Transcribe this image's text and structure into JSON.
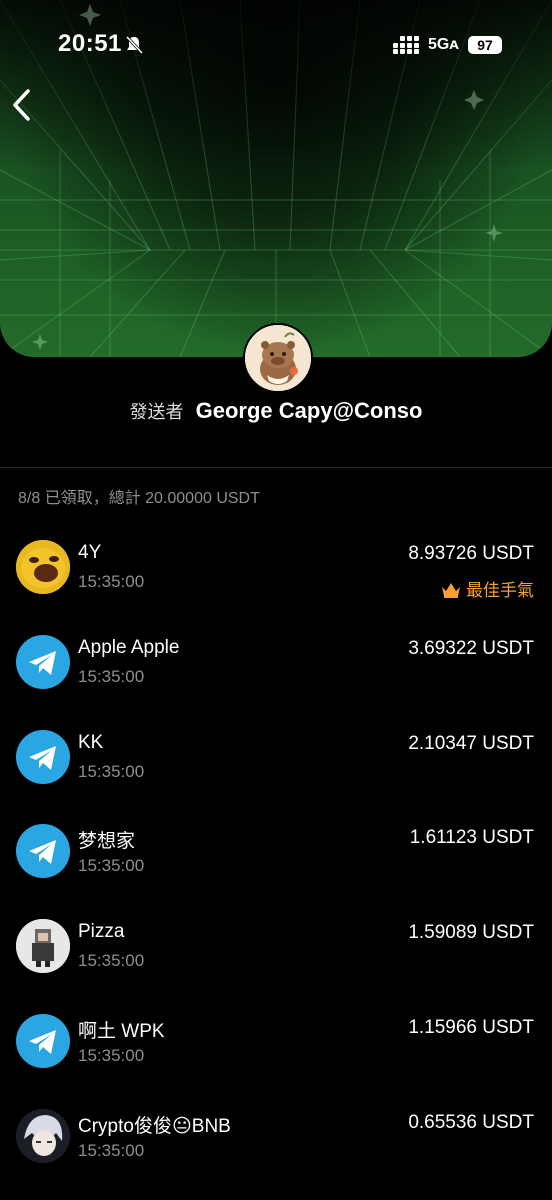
{
  "status_bar": {
    "time": "20:51",
    "network": "5Gᴀ",
    "battery": "97"
  },
  "sender": {
    "label": "發送者",
    "name": "George Capy@Conso"
  },
  "summary": "8/8 已領取，總計 20.00000 USDT",
  "best_label": "最佳手氣",
  "receivers": [
    {
      "name": "4Y",
      "time": "15:35:00",
      "amount": "8.93726 USDT",
      "avatar": "emoji-avatar",
      "best": true
    },
    {
      "name": "Apple Apple",
      "time": "15:35:00",
      "amount": "3.69322 USDT",
      "avatar": "telegram-icon"
    },
    {
      "name": "KK",
      "time": "15:35:00",
      "amount": "2.10347 USDT",
      "avatar": "telegram-icon"
    },
    {
      "name": "梦想家",
      "time": "15:35:00",
      "amount": "1.61123 USDT",
      "avatar": "telegram-icon"
    },
    {
      "name": "Pizza",
      "time": "15:35:00",
      "amount": "1.59089 USDT",
      "avatar": "pixel-avatar"
    },
    {
      "name": "啊土 WPK",
      "time": "15:35:00",
      "amount": "1.15966 USDT",
      "avatar": "telegram-icon"
    },
    {
      "name": "Crypto俊俊😐BNB",
      "time": "15:35:00",
      "amount": "0.65536 USDT",
      "avatar": "anime-avatar"
    }
  ],
  "colors": {
    "accent_green": "#1c5a24",
    "telegram_blue": "#2aa6e3",
    "best_orange": "#f5a030"
  }
}
